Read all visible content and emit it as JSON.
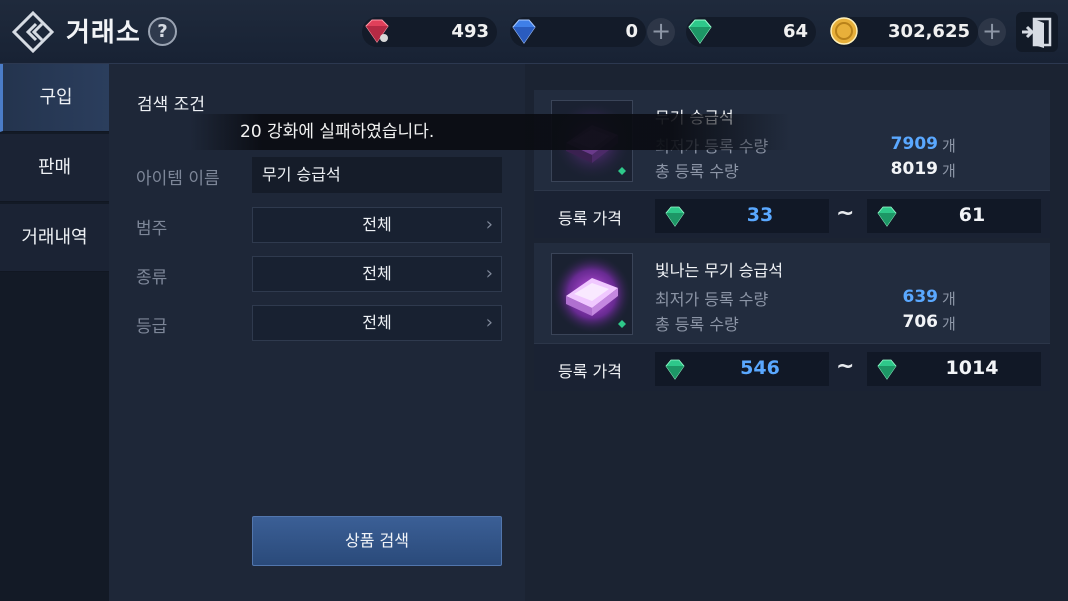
{
  "header": {
    "title": "거래소",
    "help_label": "?",
    "currencies": [
      {
        "name": "red-gem",
        "value": "493",
        "color": "#e0405a"
      },
      {
        "name": "blue-diamond",
        "value": "0",
        "color": "#3f7fe8"
      },
      {
        "name": "green-emerald",
        "value": "64",
        "color": "#2ec88a"
      },
      {
        "name": "gold-coin",
        "value": "302,625",
        "color": "#e8b03a"
      }
    ],
    "plus_label": "+"
  },
  "sidebar": {
    "tabs": [
      {
        "label": "구입",
        "active": true
      },
      {
        "label": "판매",
        "active": false
      },
      {
        "label": "거래내역",
        "active": false
      }
    ]
  },
  "search": {
    "title": "검색 조건",
    "item_name_label": "아이템 이름",
    "item_name_value": "무기 승급석",
    "category_label": "범주",
    "category_value": "전체",
    "type_label": "종류",
    "type_value": "전체",
    "grade_label": "등급",
    "grade_value": "전체",
    "button_label": "상품 검색"
  },
  "toast": {
    "message": "20 강화에 실패하였습니다."
  },
  "results": [
    {
      "name": "무기 승급석",
      "min_price_label": "최저가 등록 수량",
      "min_price_qty": "7909",
      "total_label": "총 등록 수량",
      "total_qty": "8019",
      "unit": "개",
      "price_label": "등록 가격",
      "price_min": "33",
      "price_max": "61",
      "tilde": "~"
    },
    {
      "name": "빛나는 무기 승급석",
      "min_price_label": "최저가 등록 수량",
      "min_price_qty": "639",
      "total_label": "총 등록 수량",
      "total_qty": "706",
      "unit": "개",
      "price_label": "등록 가격",
      "price_min": "546",
      "price_max": "1014",
      "tilde": "~"
    }
  ],
  "colors": {
    "accent_blue": "#5aa8ff",
    "emerald": "#2ec88a",
    "item_glow": "#c040ff"
  }
}
